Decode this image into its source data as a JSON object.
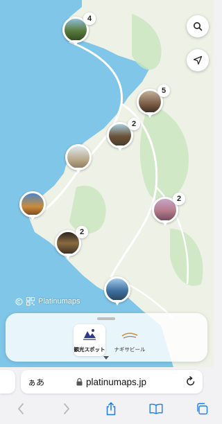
{
  "map": {
    "attribution": "Platinumaps",
    "clusters": [
      {
        "count": "4"
      },
      {
        "count": "5"
      },
      {
        "count": "2"
      },
      {
        "count": ""
      },
      {
        "count": ""
      },
      {
        "count": "2"
      },
      {
        "count": "2"
      },
      {
        "count": ""
      }
    ]
  },
  "categories": [
    {
      "label": "観光スポット",
      "active": true
    },
    {
      "label": "ナギサビール",
      "active": false
    }
  ],
  "browser": {
    "text_size_label": "ぁあ",
    "url": "platinumaps.jp"
  },
  "colors": {
    "sea": "#7fc6e8",
    "land": "#eef1e6",
    "green": "#c9e6bf",
    "road": "#ffffff",
    "accent": "#1a7cf0"
  }
}
